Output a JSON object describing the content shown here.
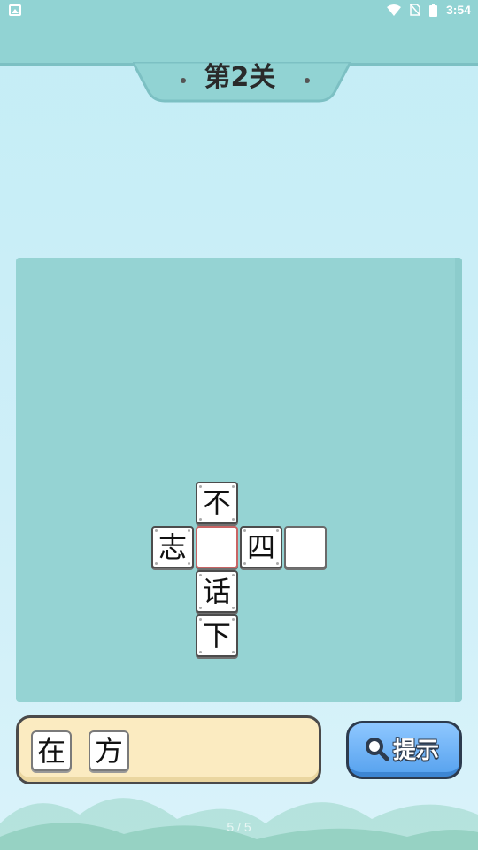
{
  "status_bar": {
    "time": "3:54",
    "icons": [
      "photo-icon",
      "wifi-icon",
      "no-sim-icon",
      "battery-icon"
    ]
  },
  "header": {
    "title": "第2关"
  },
  "board": {
    "tiles": [
      {
        "char": "不",
        "state": "filled"
      },
      {
        "char": "志",
        "state": "filled"
      },
      {
        "char": "",
        "state": "selected-empty"
      },
      {
        "char": "四",
        "state": "filled"
      },
      {
        "char": "",
        "state": "empty"
      },
      {
        "char": "话",
        "state": "filled"
      },
      {
        "char": "下",
        "state": "filled"
      }
    ]
  },
  "answer_tray": {
    "candidates": [
      "在",
      "方"
    ]
  },
  "hint_button": {
    "label": "提示",
    "icon": "search-icon"
  },
  "page_indicator": "5 / 5",
  "colors": {
    "header": "#91d3d3",
    "board": "#95d3d3",
    "tray": "#fbebc1",
    "hint_button": "#6fb4f8",
    "selected_border": "#c86464"
  }
}
